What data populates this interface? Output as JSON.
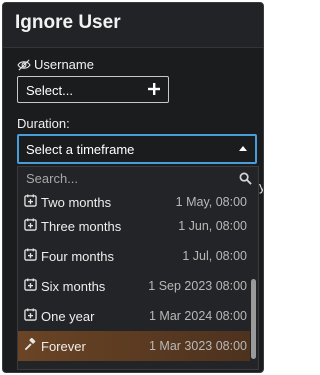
{
  "dialog": {
    "title": "Ignore User"
  },
  "username": {
    "label": "Username",
    "value": "Select..."
  },
  "duration": {
    "label": "Duration:",
    "placeholder": "Select a timeframe"
  },
  "dropdown": {
    "search_placeholder": "Search...",
    "options": [
      {
        "label": "Two months",
        "date": "1 May, 08:00",
        "icon": "calendar-plus-icon"
      },
      {
        "label": "Three months",
        "date": "1 Jun, 08:00",
        "icon": "calendar-plus-icon"
      },
      {
        "label": "Four months",
        "date": "1 Jul, 08:00",
        "icon": "calendar-plus-icon"
      },
      {
        "label": "Six months",
        "date": "1 Sep 2023 08:00",
        "icon": "calendar-plus-icon"
      },
      {
        "label": "One year",
        "date": "1 Mar 2024 08:00",
        "icon": "calendar-plus-icon"
      },
      {
        "label": "Forever",
        "date": "1 Mar 3023 08:00",
        "icon": "gavel-icon"
      }
    ]
  },
  "partial_text": {
    "right_edge": "y"
  },
  "colors": {
    "background": "#1b1c1e",
    "focus_border": "#4a9ddb",
    "highlight": "#6a4425"
  }
}
